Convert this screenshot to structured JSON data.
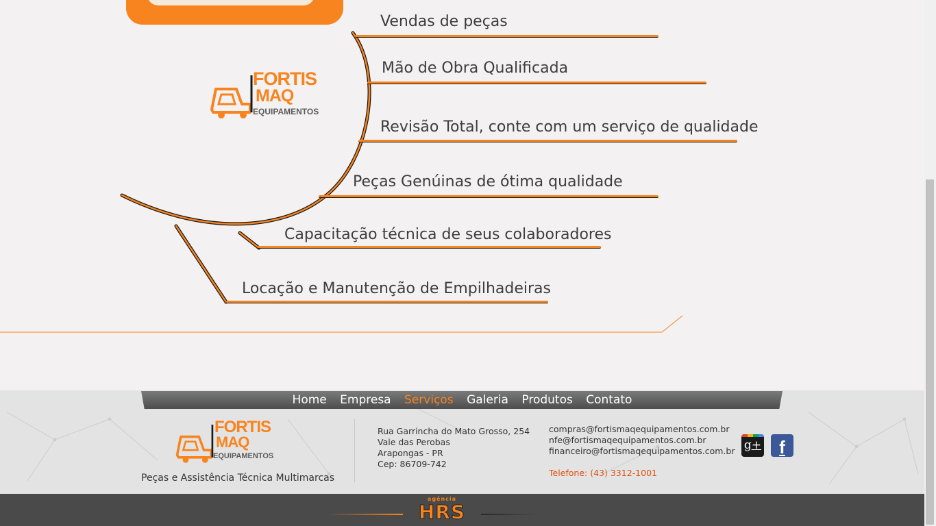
{
  "brand": {
    "name_line1": "FORTIS",
    "name_line2": "MAQ",
    "name_line3": "EQUIPAMENTOS",
    "registered_mark": "®",
    "color_orange": "#f7841e",
    "color_gray": "#5a5a5a"
  },
  "services": [
    "Vendas de peças",
    "Mão de Obra Qualificada",
    "Revisão Total, conte com um serviço de qualidade",
    "Peças Genúinas de ótima qualidade",
    "Capacitação técnica de seus colaboradores",
    "Locação e Manutenção de Empilhadeiras"
  ],
  "nav": {
    "items": [
      "Home",
      "Empresa",
      "Serviços",
      "Galeria",
      "Produtos",
      "Contato"
    ],
    "active": "Serviços"
  },
  "footer": {
    "tagline": "Peças e Assistência Técnica Multimarcas",
    "address": [
      "Rua Garrincha do Mato Grosso, 254",
      "Vale das Perobas",
      "Arapongas - PR",
      "Cep: 86709-742"
    ],
    "emails": [
      "compras@fortismaqequipamentos.com.br",
      "nfe@fortismaqequipamentos.com.br",
      "financeiro@fortismaqequipamentos.com.br"
    ],
    "phone": "Telefone: (43) 3312-1001",
    "social": [
      {
        "name": "google-plus-icon",
        "glyph": "g+"
      },
      {
        "name": "facebook-icon",
        "glyph": "f"
      }
    ]
  },
  "agency": {
    "small": "agência",
    "big": "HRS"
  }
}
